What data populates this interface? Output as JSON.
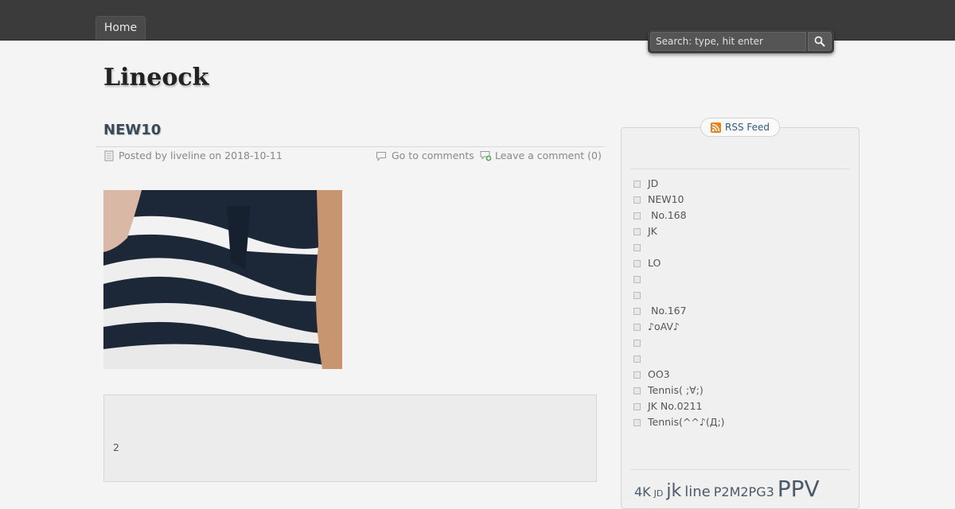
{
  "nav": {
    "home": "Home"
  },
  "search": {
    "placeholder": "Search: type, hit enter"
  },
  "site": {
    "title": "Lineock"
  },
  "post": {
    "title": "NEW10",
    "posted_by": "Posted by liveline on 2018-10-11",
    "go_to_comments": "Go to comments",
    "leave_comment": "Leave a comment (0)",
    "quote_text": "2"
  },
  "sidebar": {
    "rss_label": "RSS Feed",
    "items": [
      {
        "label": "JD"
      },
      {
        "label": "NEW10"
      },
      {
        "label": " No.168"
      },
      {
        "label": "JK"
      },
      {
        "label": ""
      },
      {
        "label": "LO"
      },
      {
        "label": ""
      },
      {
        "label": ""
      },
      {
        "label": " No.167"
      },
      {
        "label": "♪oAV♪"
      },
      {
        "label": ""
      },
      {
        "label": ""
      },
      {
        "label": "OO3"
      },
      {
        "label": "Tennis( ;∀;)"
      },
      {
        "label": "JK No.0211"
      },
      {
        "label": "Tennis(^^♪(Д;)"
      }
    ],
    "tags": [
      "4K",
      "JD",
      "jk",
      "line",
      "P2M2PG3",
      "PPV"
    ]
  },
  "colors": {
    "topbar": "#3b3b3b",
    "link": "#2e5b86",
    "rss_orange": "#e8821e"
  }
}
